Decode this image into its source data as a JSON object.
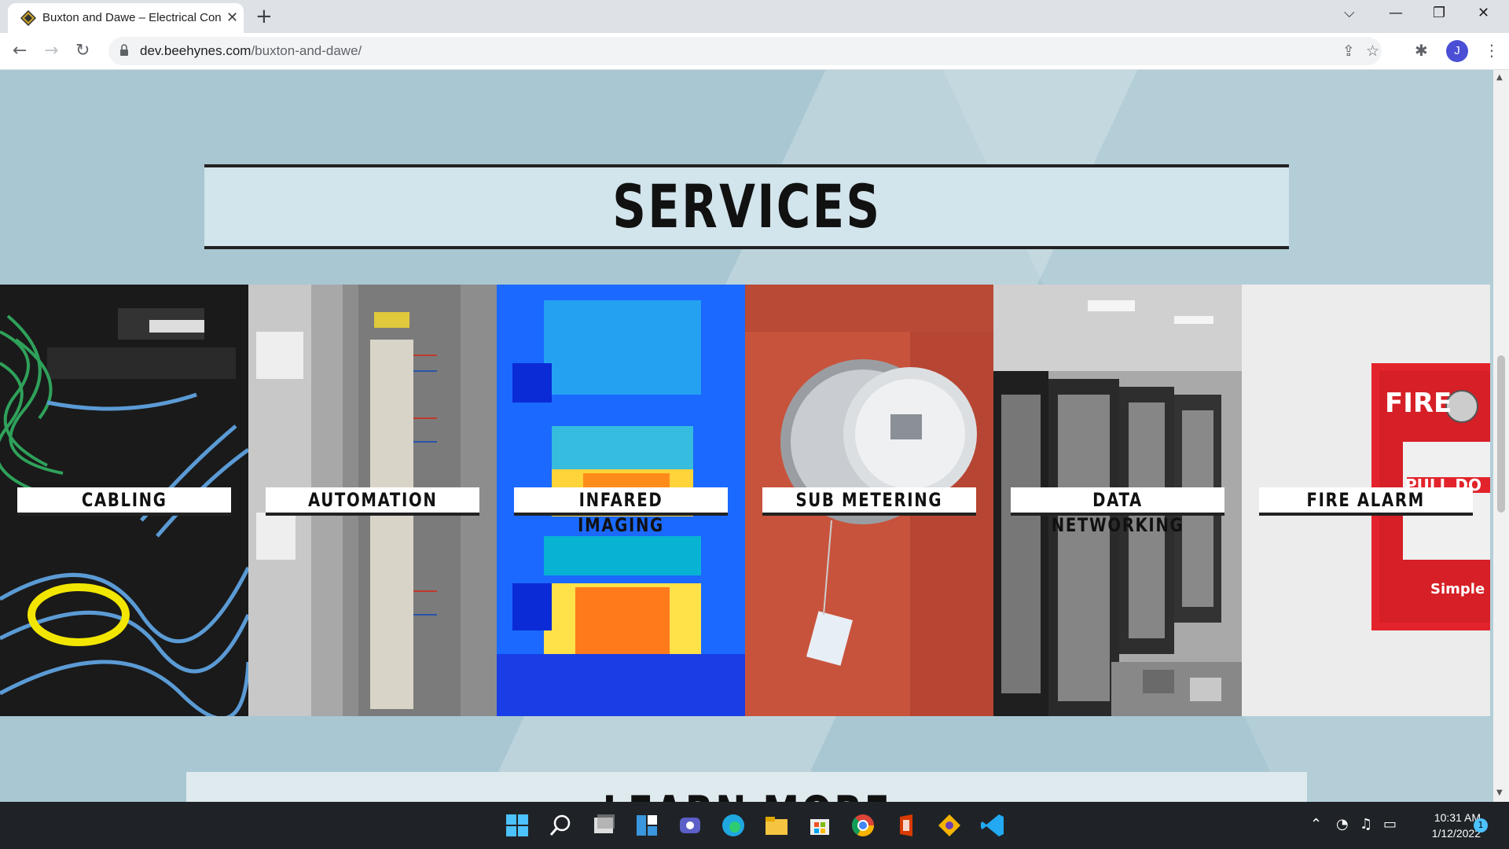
{
  "browser": {
    "tab_title": "Buxton and Dawe – Electrical Con",
    "url_host": "dev.beehynes.com",
    "url_path": "/buxton-and-dawe/",
    "profile_initial": "J"
  },
  "page": {
    "services_title": "SERVICES",
    "tiles": [
      {
        "label": "CABLING",
        "icon": "cabling-photo"
      },
      {
        "label": "AUTOMATION",
        "icon": "automation-photo"
      },
      {
        "label": "INFARED IMAGING",
        "icon": "thermal-photo"
      },
      {
        "label": "SUB METERING",
        "icon": "meter-photo"
      },
      {
        "label": "DATA NETWORKING",
        "icon": "server-photo"
      },
      {
        "label": "FIRE ALARM",
        "icon": "fire-alarm-photo"
      }
    ],
    "learn_more": "LEARN MORE",
    "fire_text": "FIRE",
    "pull_text": "PULL DO",
    "brand_text": "Simple"
  },
  "taskbar": {
    "time": "10:31 AM",
    "date": "1/12/2022",
    "notification_count": "1"
  }
}
